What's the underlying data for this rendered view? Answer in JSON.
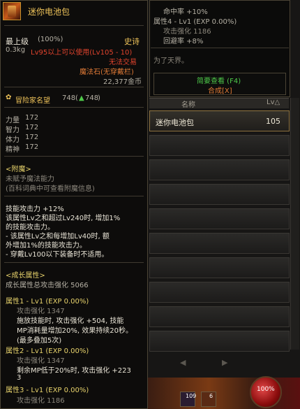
{
  "item": {
    "name": "迷你电池包",
    "max_level": "最上级",
    "percent": "(100%)",
    "rarity": "史诗",
    "weight": "0.3kg",
    "level_req": "Lv95以上可以使用(Lv105 - 10)",
    "no_trade": "无法交易",
    "slot_type": "魔法石(无穿戴栏)",
    "price": "22,377金币"
  },
  "fame": {
    "label": "冒险家名望",
    "value": "748",
    "arrow": "▲",
    "value2": "748"
  },
  "stats": [
    {
      "label": "力量",
      "value": "172"
    },
    {
      "label": "智力",
      "value": "172"
    },
    {
      "label": "体力",
      "value": "172"
    },
    {
      "label": "精神",
      "value": "172"
    }
  ],
  "enchant": {
    "title": "<附魔>",
    "line1": "未赋予魔法能力",
    "line2": "(百科词典中可查看附魔信息)"
  },
  "skill": {
    "line1": "技能攻击力 +12%",
    "line2": "该属性Lv之和超过Lv240时, 增加1%",
    "line3": "的技能攻击力。",
    "line4": "- 该属性Lv之和每增加Lv40时, 额",
    "line5": "外增加1%的技能攻击力。",
    "line6": "- 穿戴Lv100以下装备时不适用。"
  },
  "growth": {
    "title": "<成长属性>",
    "total": "成长属性总攻击强化 5066",
    "attr1": {
      "label": "属性1 - Lv1 (EXP 0.00%)",
      "atk": "攻击强化 1347",
      "d1": "施放技能时, 攻击强化 +504, 技能",
      "d2": "MP消耗量增加20%, 效果持续20秒。",
      "d3": "(最多叠加5次)"
    },
    "attr2": {
      "label": "属性2 - Lv1 (EXP 0.00%)",
      "atk": "攻击强化 1347",
      "d1": "剩余MP低于20%时, 攻击强化 +223",
      "d2": "3"
    },
    "attr3": {
      "label": "属性3 - Lv1 (EXP 0.00%)",
      "atk": "攻击强化 1186"
    }
  },
  "tip2": {
    "hit": "命中率 +10%",
    "attr4": "属性4 - Lv1 (EXP 0.00%)",
    "atk": "攻击强化 1186",
    "evade": "回避率 +8%",
    "flavor": "为了天界。",
    "brief": "简要查看 (F4)",
    "synth": "合成[X]"
  },
  "list": {
    "col_name": "名称",
    "col_lv": "Lv△",
    "rows": [
      {
        "name": "迷你电池包",
        "price": "105"
      }
    ],
    "prev": "◀",
    "next": "▶"
  },
  "hud": {
    "hp": "100%",
    "q1": "109",
    "q2": "6"
  }
}
